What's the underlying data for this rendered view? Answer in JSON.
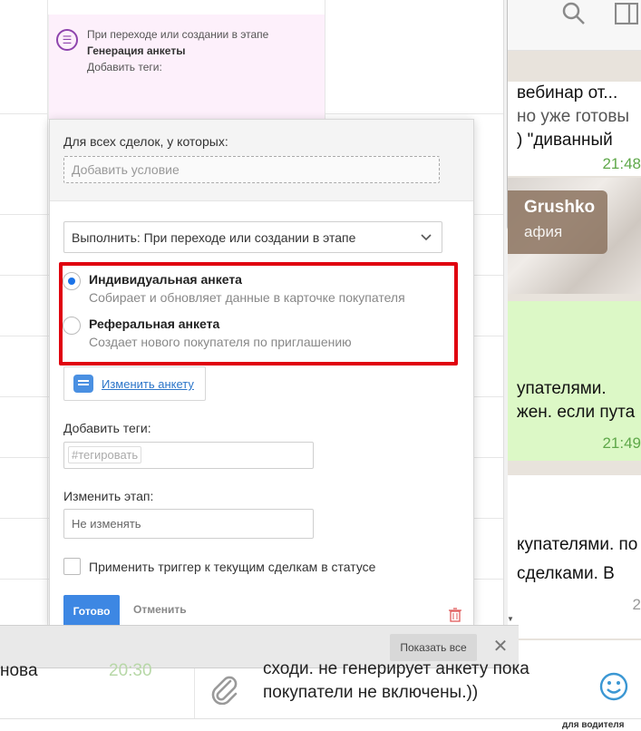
{
  "stage_card": {
    "line1": "При переходе или создании в этапе",
    "line2": "Генерация анкеты",
    "line3": "Добавить теги:"
  },
  "popup": {
    "condition_label": "Для всех сделок, у которых:",
    "condition_placeholder": "Добавить условие",
    "execute_select": "Выполнить: При переходе или создании в этапе",
    "options": [
      {
        "title": "Индивидуальная анкета",
        "subtitle": "Собирает и обновляет данные в карточке покупателя",
        "selected": true
      },
      {
        "title": "Реферальная анкета",
        "subtitle": "Создает нового покупателя по приглашению",
        "selected": false
      }
    ],
    "edit_form_link": "Изменить анкету",
    "tags_label": "Добавить теги:",
    "tags_placeholder": "#тегировать",
    "stage_label": "Изменить этап:",
    "stage_value": "Не изменять",
    "apply_checkbox_label": "Применить триггер к текущим сделкам в статусе",
    "done_button": "Готово",
    "cancel_button": "Отменить"
  },
  "bottom_bar": {
    "show_all_button": "Показать все",
    "close_symbol": "✕"
  },
  "chat": {
    "messages": [
      {
        "text": "вебинар от...",
        "time": ""
      },
      {
        "text": "но уже готовы",
        "time": ""
      },
      {
        "text": ")  \"диванный",
        "time": ""
      },
      {
        "text": "",
        "time": "21:48"
      },
      {
        "text": "упателями.",
        "time": ""
      },
      {
        "text": "жен. если пута",
        "time": ""
      },
      {
        "text": "",
        "time": "21:49"
      },
      {
        "text": "купателями. по",
        "time": ""
      },
      {
        "text": "сделками. В",
        "time": ""
      },
      {
        "text": "",
        "time": "2"
      }
    ],
    "photo_caption_name": "Grushko",
    "photo_caption_sub": "афия",
    "composer_line1": "сходи. не генерирует анкету пока",
    "composer_line2": "покупатели не включены.))",
    "bottom_left_text": "нова",
    "bottom_left_num": "20:30",
    "driver_label": "для водителя"
  },
  "colors": {
    "accent": "#3d87e3",
    "highlight": "#e0000f",
    "stage_bg": "#fdf0fb",
    "bubble_green": "#dcf8c6"
  }
}
